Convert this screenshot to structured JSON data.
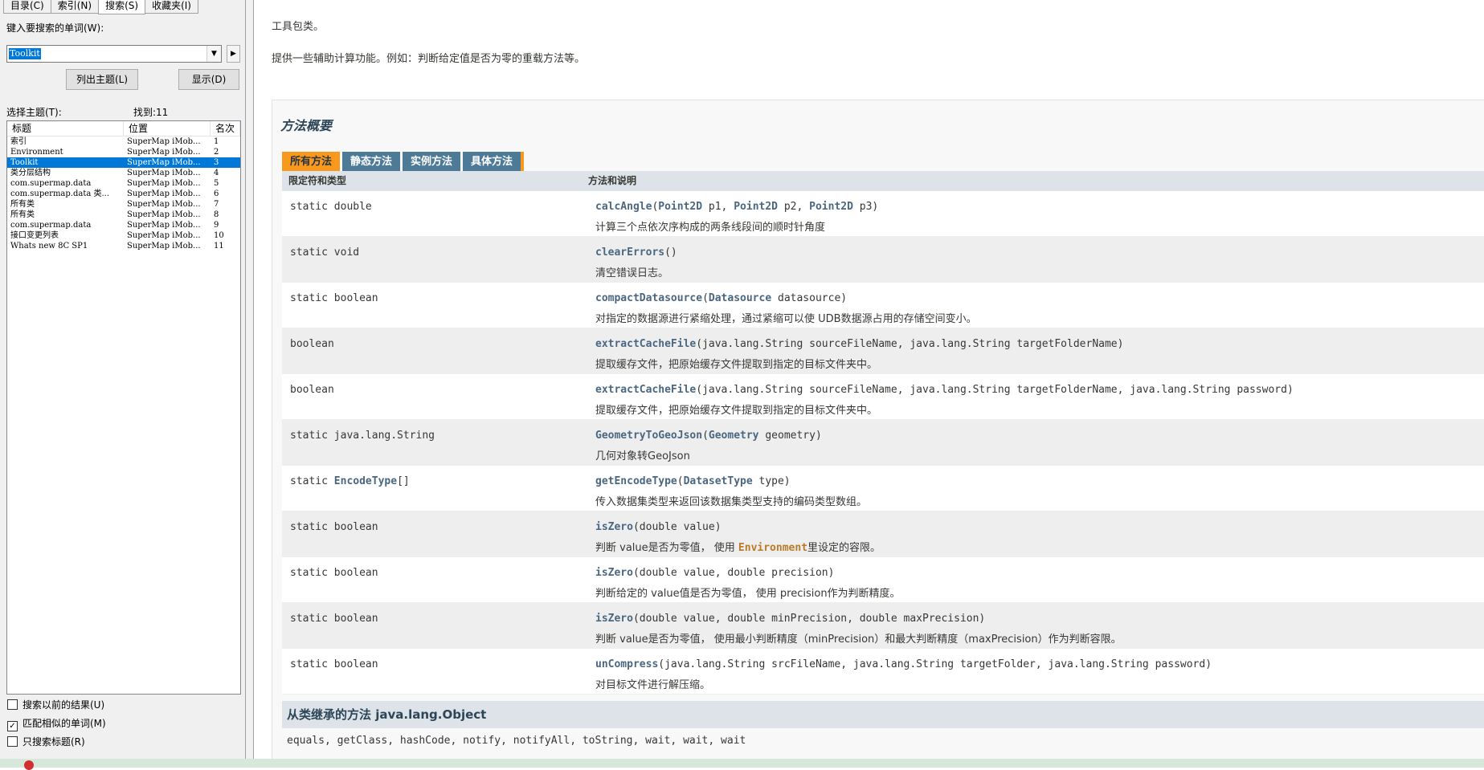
{
  "left": {
    "tabs": [
      "目录(C)",
      "索引(N)",
      "搜索(S)",
      "收藏夹(I)"
    ],
    "search_label": "键入要搜索的单词(W):",
    "search_value": "Toolkit",
    "list_button": "列出主题(L)",
    "show_button": "显示(D)",
    "select_label": "选择主题(T):",
    "found_label": "找到:11",
    "columns": [
      "标题",
      "位置",
      "名次"
    ],
    "results": [
      {
        "title": "索引",
        "location": "SuperMap iMob...",
        "rank": "1"
      },
      {
        "title": "Environment",
        "location": "SuperMap iMob...",
        "rank": "2"
      },
      {
        "title": "Toolkit",
        "location": "SuperMap iMob...",
        "rank": "3"
      },
      {
        "title": "类分层结构",
        "location": "SuperMap iMob...",
        "rank": "4"
      },
      {
        "title": "com.supermap.data",
        "location": "SuperMap iMob...",
        "rank": "5"
      },
      {
        "title": "com.supermap.data 类...",
        "location": "SuperMap iMob...",
        "rank": "6"
      },
      {
        "title": "所有类",
        "location": "SuperMap iMob...",
        "rank": "7"
      },
      {
        "title": "所有类",
        "location": "SuperMap iMob...",
        "rank": "8"
      },
      {
        "title": "com.supermap.data",
        "location": "SuperMap iMob...",
        "rank": "9"
      },
      {
        "title": "接口变更列表",
        "location": "SuperMap iMob...",
        "rank": "10"
      },
      {
        "title": "Whats new 8C SP1",
        "location": "SuperMap iMob...",
        "rank": "11"
      }
    ],
    "checkboxes": [
      {
        "label": "搜索以前的结果(U)",
        "checked": false
      },
      {
        "label": "匹配相似的单词(M)",
        "checked": true
      },
      {
        "label": "只搜索标题(R)",
        "checked": false
      }
    ]
  },
  "doc": {
    "intro1": "工具包类。",
    "intro2": "提供一些辅助计算功能。例如：判断给定值是否为零的重载方法等。",
    "summary_title": "方法概要",
    "tabs": [
      "所有方法",
      "静态方法",
      "实例方法",
      "具体方法"
    ],
    "col_headers": [
      "限定符和类型",
      "方法和说明"
    ],
    "methods": [
      {
        "mod": "static double",
        "name": "calcAngle",
        "desc": "计算三个点依次序构成的两条线段间的顺时针角度"
      },
      {
        "mod": "static void",
        "name": "clearErrors",
        "desc": "清空错误日志。"
      },
      {
        "mod": "static boolean",
        "name": "compactDatasource",
        "desc": "对指定的数据源进行紧缩处理，通过紧缩可以使 UDB数据源占用的存储空间变小。"
      },
      {
        "mod": "boolean",
        "name": "extractCacheFile",
        "desc": "提取缓存文件，把原始缓存文件提取到指定的目标文件夹中。"
      },
      {
        "mod": "boolean",
        "name": "extractCacheFile",
        "desc": "提取缓存文件，把原始缓存文件提取到指定的目标文件夹中。"
      },
      {
        "mod": "static java.lang.String",
        "name": "GeometryToGeoJson",
        "desc": "几何对象转GeoJson"
      },
      {
        "mod_prefix": "static ",
        "mod_link": "EncodeType",
        "mod_suffix": "[]",
        "name": "getEncodeType",
        "desc": "传入数据集类型来返回该数据集类型支持的编码类型数组。"
      },
      {
        "mod": "static boolean",
        "name": "isZero",
        "desc_a": "判断 value是否为零值， 使用",
        "desc_link": "Environment",
        "desc_b": "里设定的容限。"
      },
      {
        "mod": "static boolean",
        "name": "isZero",
        "desc": "判断给定的 value值是否为零值， 使用 precision作为判断精度。"
      },
      {
        "mod": "static boolean",
        "name": "isZero",
        "desc": "判断 value是否为零值， 使用最小判断精度（minPrecision）和最大判断精度（maxPrecision）作为判断容限。"
      },
      {
        "mod": "static boolean",
        "name": "unCompress",
        "desc": "对目标文件进行解压缩。"
      }
    ],
    "sig": {
      "m0": {
        "t1": "Point2D",
        "p1": " p1, ",
        "t2": "Point2D",
        "p2": " p2, ",
        "t3": "Point2D",
        "p3": " p3)"
      },
      "m1": "()",
      "m2": {
        "t1": "Datasource",
        "p1": " datasource)"
      },
      "m3": "(java.lang.String sourceFileName, java.lang.String targetFolderName)",
      "m4": "(java.lang.String sourceFileName, java.lang.String targetFolderName, java.lang.String password)",
      "m5": {
        "t1": "Geometry",
        "p1": " geometry)"
      },
      "m6": {
        "t1": "DatasetType",
        "p1": " type)"
      },
      "m7": "(double value)",
      "m8": "(double value, double precision)",
      "m9": "(double value, double minPrecision, double maxPrecision)",
      "m10": "(java.lang.String srcFileName, java.lang.String targetFolder, java.lang.String password)"
    },
    "inherit_title": "从类继承的方法 java.lang.Object",
    "inherit_list": "equals, getClass, hashCode, notify, notifyAll, toString, wait, wait, wait"
  }
}
